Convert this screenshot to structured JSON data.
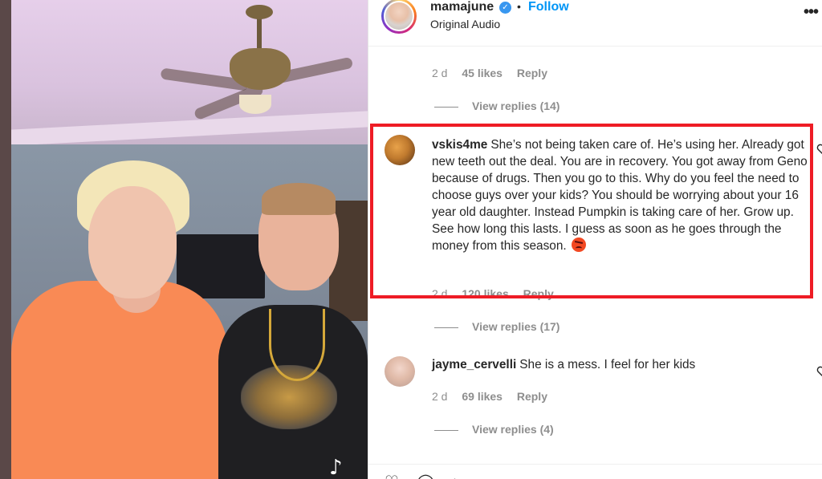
{
  "post": {
    "username": "mamajune",
    "verified_mark": "✓",
    "dot": "•",
    "follow_label": "Follow",
    "audio": "Original Audio",
    "more_icon": "more-options-icon"
  },
  "comments": [
    {
      "meta": {
        "age": "2 d",
        "likes": "45 likes",
        "reply": "Reply"
      },
      "view_replies": "View replies (14)"
    },
    {
      "username": "vskis4me",
      "text": "She’s not being taken care of. He’s using her. Already got new teeth out the deal. You are in recovery. You got away from Geno because of drugs. Then you go to this. Why do you feel the need to choose guys over your kids? You should be worrying about your 16 year old daughter. Instead Pumpkin is taking care of her. Grow up. See how long this lasts. I guess as soon as he goes through the money from this season.",
      "emoji": "angry-face-emoji",
      "meta": {
        "age": "2 d",
        "likes": "120 likes",
        "reply": "Reply"
      },
      "view_replies": "View replies (17)",
      "highlight_color": "#ee1c25"
    },
    {
      "username": "jayme_cervelli",
      "text": "She is a mess. I feel for her kids",
      "meta": {
        "age": "2 d",
        "likes": "69 likes",
        "reply": "Reply"
      },
      "view_replies": "View replies (4)"
    }
  ],
  "video": {
    "watermark": "♪"
  },
  "colors": {
    "follow": "#0095f6",
    "verified": "#3897f0",
    "highlight": "#ee1c25",
    "muted_text": "#8e8e8e"
  }
}
